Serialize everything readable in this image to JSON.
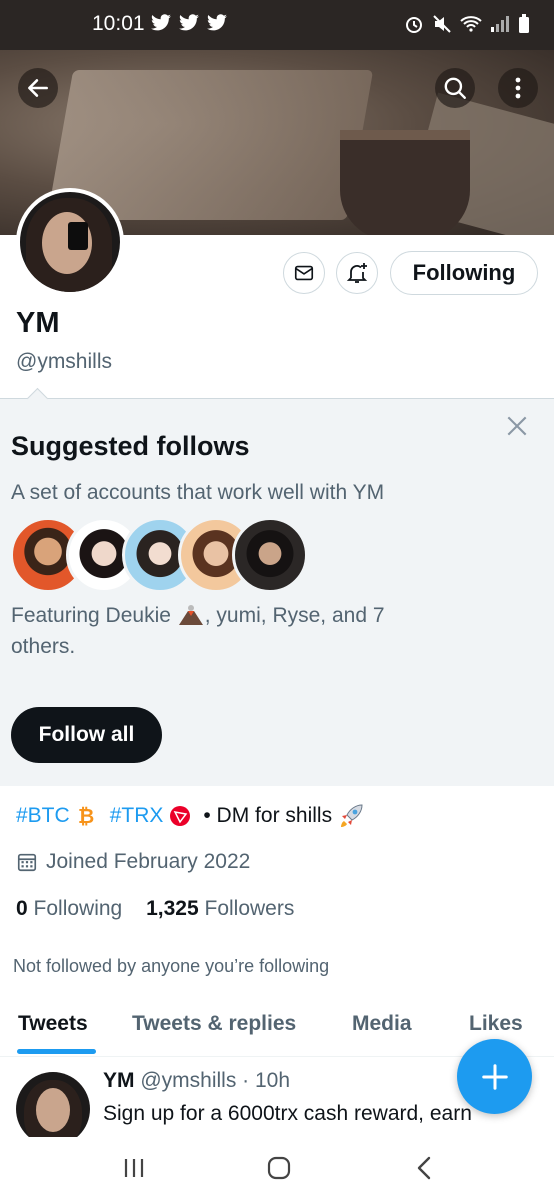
{
  "status_bar": {
    "time": "10:01"
  },
  "profile": {
    "name": "YM",
    "handle": "@ymshills",
    "follow_state_label": "Following",
    "bio": {
      "tag1": "#BTC",
      "tag2": "#TRX",
      "rest": "• DM for shills"
    },
    "joined": "Joined February 2022",
    "following_count": "0",
    "following_label": "Following",
    "followers_count": "1,325",
    "followers_label": "Followers",
    "not_followed_note": "Not followed by anyone you’re following"
  },
  "suggested": {
    "title": "Suggested follows",
    "subtitle": "A set of accounts that work well with YM",
    "featuring_prefix": "Featuring Deukie",
    "featuring_rest": ", yumi, Ryse, and 7 others.",
    "follow_all_label": "Follow all"
  },
  "tabs": [
    {
      "label": "Tweets",
      "active": true
    },
    {
      "label": "Tweets & replies",
      "active": false
    },
    {
      "label": "Media",
      "active": false
    },
    {
      "label": "Likes",
      "active": false
    }
  ],
  "tweet": {
    "name": "YM",
    "handle_time": "@ymshills · 10h",
    "text": "Sign up for a 6000trx cash reward, earn"
  },
  "colors": {
    "accent": "#1d9bf0",
    "status_bar": "#2b2624",
    "suggest_bg": "#f1f4f6",
    "text_primary": "#0f1419",
    "text_secondary": "#536471"
  },
  "icons": [
    "back-arrow-icon",
    "search-icon",
    "more-vertical-icon",
    "mail-icon",
    "bell-plus-icon",
    "close-icon",
    "calendar-icon",
    "plus-icon",
    "nav-recents-icon",
    "nav-home-icon",
    "nav-back-icon"
  ]
}
